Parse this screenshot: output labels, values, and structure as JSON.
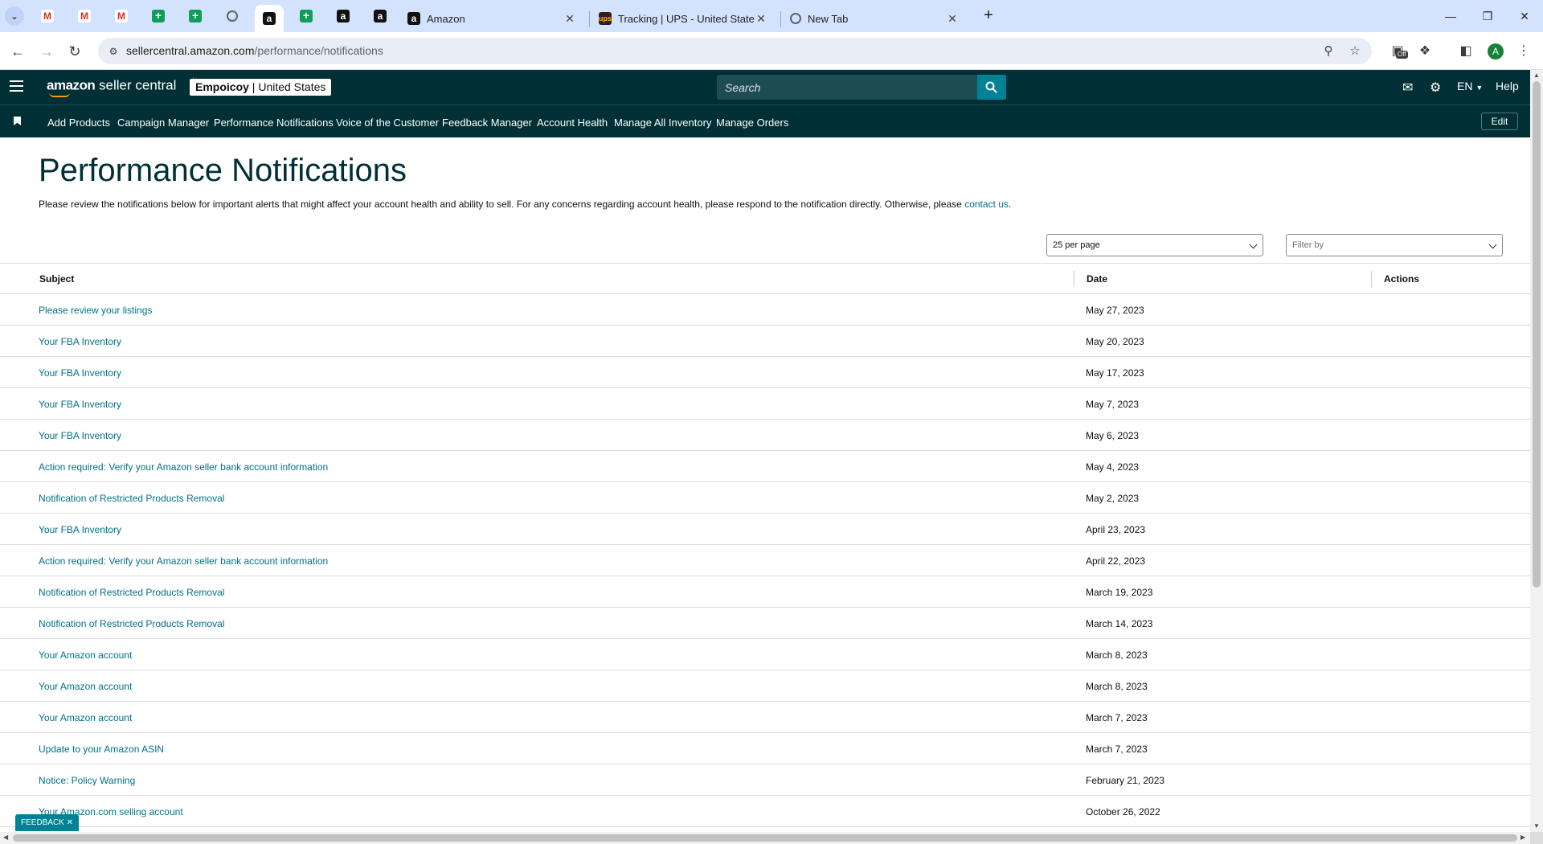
{
  "browser": {
    "active_tab_title": "Amazon",
    "tabs": [
      {
        "title": "Amazon",
        "icon": "amazon-icon"
      },
      {
        "title": "Tracking | UPS - United States",
        "icon": "ups-icon"
      },
      {
        "title": "New Tab",
        "icon": "chrome-icon"
      }
    ],
    "pinned_tab_icons": [
      "gmail-icon",
      "gmail-icon",
      "gmail-icon",
      "sheets-icon",
      "sheets-icon",
      "globe-icon",
      "amazon-icon",
      "sheets-icon",
      "amazon-icon",
      "amazon-icon"
    ],
    "url_host": "sellercentral.amazon.com",
    "url_path": "/performance/notifications",
    "profile_initial": "A",
    "extension_badge": "Off"
  },
  "header": {
    "logo_brand": "amazon",
    "logo_product": "seller central",
    "store_name": "Empoicoy",
    "store_region": "United States",
    "search_placeholder": "Search",
    "language": "EN",
    "help": "Help"
  },
  "nav": {
    "links": [
      "Add Products",
      "Campaign Manager",
      "Performance Notifications",
      "Voice of the Customer",
      "Feedback Manager",
      "Account Health",
      "Manage All Inventory",
      "Manage Orders"
    ],
    "edit": "Edit"
  },
  "page": {
    "title": "Performance Notifications",
    "description": "Please review the notifications below for important alerts that might affect your account health and ability to sell. For any concerns regarding account health, please respond to the notification directly. Otherwise, please",
    "contact_link": "contact us",
    "per_page": "25 per page",
    "filter_placeholder": "Filter by"
  },
  "table": {
    "columns": [
      "Subject",
      "Date",
      "Actions"
    ],
    "rows": [
      {
        "subject": "Please review your listings",
        "date": "May 27, 2023"
      },
      {
        "subject": "Your FBA Inventory",
        "date": "May 20, 2023"
      },
      {
        "subject": "Your FBA Inventory",
        "date": "May 17, 2023"
      },
      {
        "subject": "Your FBA Inventory",
        "date": "May 7, 2023"
      },
      {
        "subject": "Your FBA Inventory",
        "date": "May 6, 2023"
      },
      {
        "subject": "Action required: Verify your Amazon seller bank account information",
        "date": "May 4, 2023"
      },
      {
        "subject": "Notification of Restricted Products Removal",
        "date": "May 2, 2023"
      },
      {
        "subject": "Your FBA Inventory",
        "date": "April 23, 2023"
      },
      {
        "subject": "Action required: Verify your Amazon seller bank account information",
        "date": "April 22, 2023"
      },
      {
        "subject": "Notification of Restricted Products Removal",
        "date": "March 19, 2023"
      },
      {
        "subject": "Notification of Restricted Products Removal",
        "date": "March 14, 2023"
      },
      {
        "subject": "Your Amazon account",
        "date": "March 8, 2023"
      },
      {
        "subject": "Your Amazon account",
        "date": "March 8, 2023"
      },
      {
        "subject": "Your Amazon account",
        "date": "March 7, 2023"
      },
      {
        "subject": "Update to your Amazon ASIN",
        "date": "March 7, 2023"
      },
      {
        "subject": "Notice: Policy Warning",
        "date": "February 21, 2023"
      },
      {
        "subject": "Your Amazon.com selling account",
        "date": "October 26, 2022"
      }
    ]
  },
  "feedback": {
    "label": "FEEDBACK"
  },
  "colors": {
    "header_bg": "#002f36",
    "link": "#007185",
    "search_button": "#008296",
    "tabbar": "#d3e3fd"
  }
}
